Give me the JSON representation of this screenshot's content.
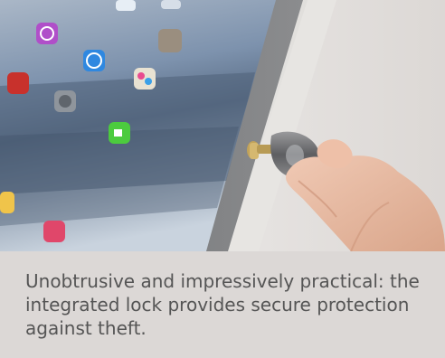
{
  "caption": "Unobtrusive and impressively practical: the integrated lock provides secure protection against theft.",
  "photo": {
    "subject": "Tablet in white secure stand with a key inserted into the integrated lock",
    "icons": [
      "music-app-icon",
      "app-store-icon",
      "contacts-app-icon",
      "photo-booth-app-icon",
      "settings-icon",
      "game-center-icon",
      "facetime-icon",
      "itunes-icon",
      "tips-icon"
    ]
  },
  "colors": {
    "caption_band": "#dcd8d6",
    "caption_text": "#555555",
    "stand_frame": "#f2f1ef",
    "bezel": "#7d7e80"
  }
}
